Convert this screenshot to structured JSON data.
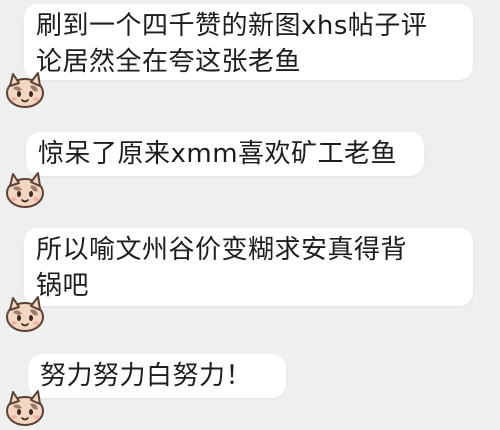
{
  "chat": {
    "background_color": "#efefef",
    "bubble_color": "#ffffff",
    "messages": [
      {
        "lines": [
          "刷到一个四千赞的新图xhs帖子评",
          "论居然全在夸这张老鱼"
        ],
        "avatar_icon": "cat-avatar-icon"
      },
      {
        "lines": [
          "惊呆了原来xmm喜欢矿工老鱼"
        ],
        "avatar_icon": "cat-avatar-icon"
      },
      {
        "lines": [
          "所以喻文州谷价变糊求安真得背",
          "锅吧"
        ],
        "avatar_icon": "cat-avatar-icon"
      },
      {
        "lines": [
          "努力努力白努力！"
        ],
        "avatar_icon": "cat-avatar-icon"
      }
    ]
  }
}
